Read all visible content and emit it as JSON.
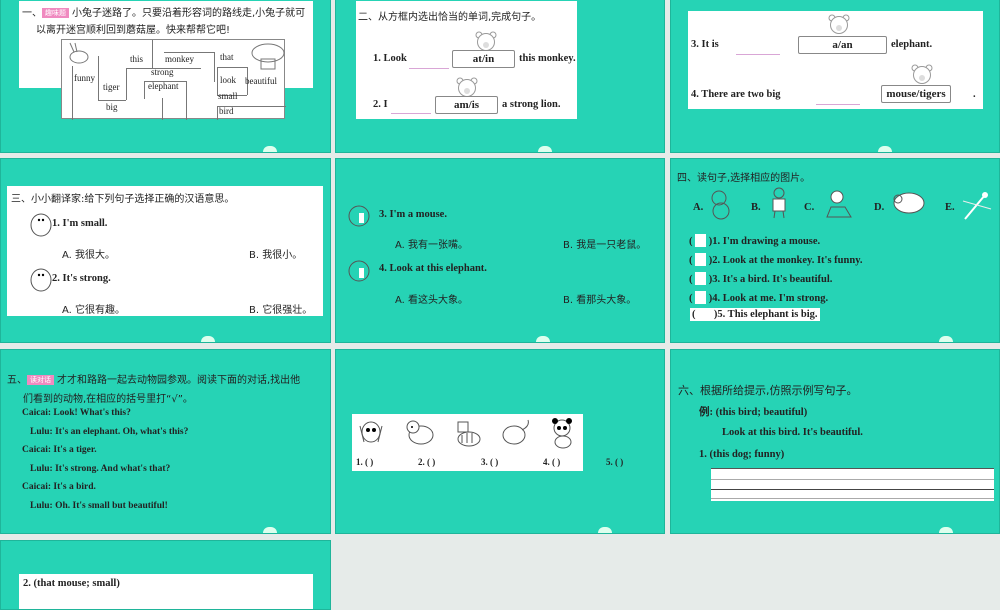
{
  "s1": {
    "prefix": "一、",
    "tag": "趣味题",
    "line1": "小兔子迷路了。只要沿着形容词的路线走,小兔子就可",
    "line2": "以离开迷宫顺利回到蘑菇屋。快来帮帮它吧!",
    "maze": [
      "this",
      "monkey",
      "that",
      "strong",
      "funny",
      "tiger",
      "elephant",
      "look",
      "beautiful",
      "small",
      "big",
      "bird"
    ]
  },
  "s2": {
    "title": "二、从方框内选出恰当的单词,完成句子。",
    "q1a": "1. Look",
    "q1box": "at/in",
    "q1b": "this monkey.",
    "q2a": "2. I",
    "q2box": "am/is",
    "q2b": "a strong lion."
  },
  "s3": {
    "q3a": "3. It is",
    "q3box": "a/an",
    "q3b": "elephant.",
    "q4a": "4. There are two big",
    "q4box": "mouse/tigers",
    "q4b": "."
  },
  "s4": {
    "title": "三、小小翻译家:给下列句子选择正确的汉语意思。",
    "q1": "1. I'm small.",
    "q1A": "A. 我很大。",
    "q1B": "B. 我很小。",
    "q2": "2. It's strong.",
    "q2A": "A. 它很有趣。",
    "q2B": "B. 它很强壮。"
  },
  "s5": {
    "q3": "3. I'm a mouse.",
    "q3A": "A. 我有一张嘴。",
    "q3B": "B. 我是一只老鼠。",
    "q4": "4. Look at this elephant.",
    "q4A": "A. 看这头大象。",
    "q4B": "B. 看那头大象。"
  },
  "s6": {
    "title": "四、读句子,选择相应的图片。",
    "opts": [
      "A.",
      "B.",
      "C.",
      "D.",
      "E."
    ],
    "items": [
      "1. I'm drawing a mouse.",
      "2. Look at the monkey. It's funny.",
      "3. It's a bird. It's beautiful.",
      "4. Look at me. I'm strong.",
      "5. This elephant is big."
    ]
  },
  "s7": {
    "prefix": "五、",
    "tag": "读对话",
    "line1": "才才和路路一起去动物园参观。阅读下面的对话,找出他",
    "line2": "们看到的动物,在相应的括号里打“√”。",
    "dialog": [
      "Caicai: Look! What's this?",
      "Lulu: It's an elephant. Oh, what's this?",
      "Caicai: It's a tiger.",
      "Lulu: It's strong. And what's that?",
      "Caicai: It's a bird.",
      "Lulu: Oh. It's small but beautiful!"
    ]
  },
  "s8": {
    "labels": [
      "1. (       )",
      "2. (       )",
      "3. (       )",
      "4. (       )",
      "5. (       )"
    ]
  },
  "s9": {
    "title": "六、根据所给提示,仿照示例写句子。",
    "example": "例: (this bird; beautiful)",
    "answer": "Look at this bird. It's beautiful.",
    "q1": "1. (this dog; funny)"
  },
  "s10": {
    "q2": "2. (that mouse; small)"
  },
  "colors": {
    "teal": "#26d3b5",
    "tag": "#f08ac0"
  }
}
